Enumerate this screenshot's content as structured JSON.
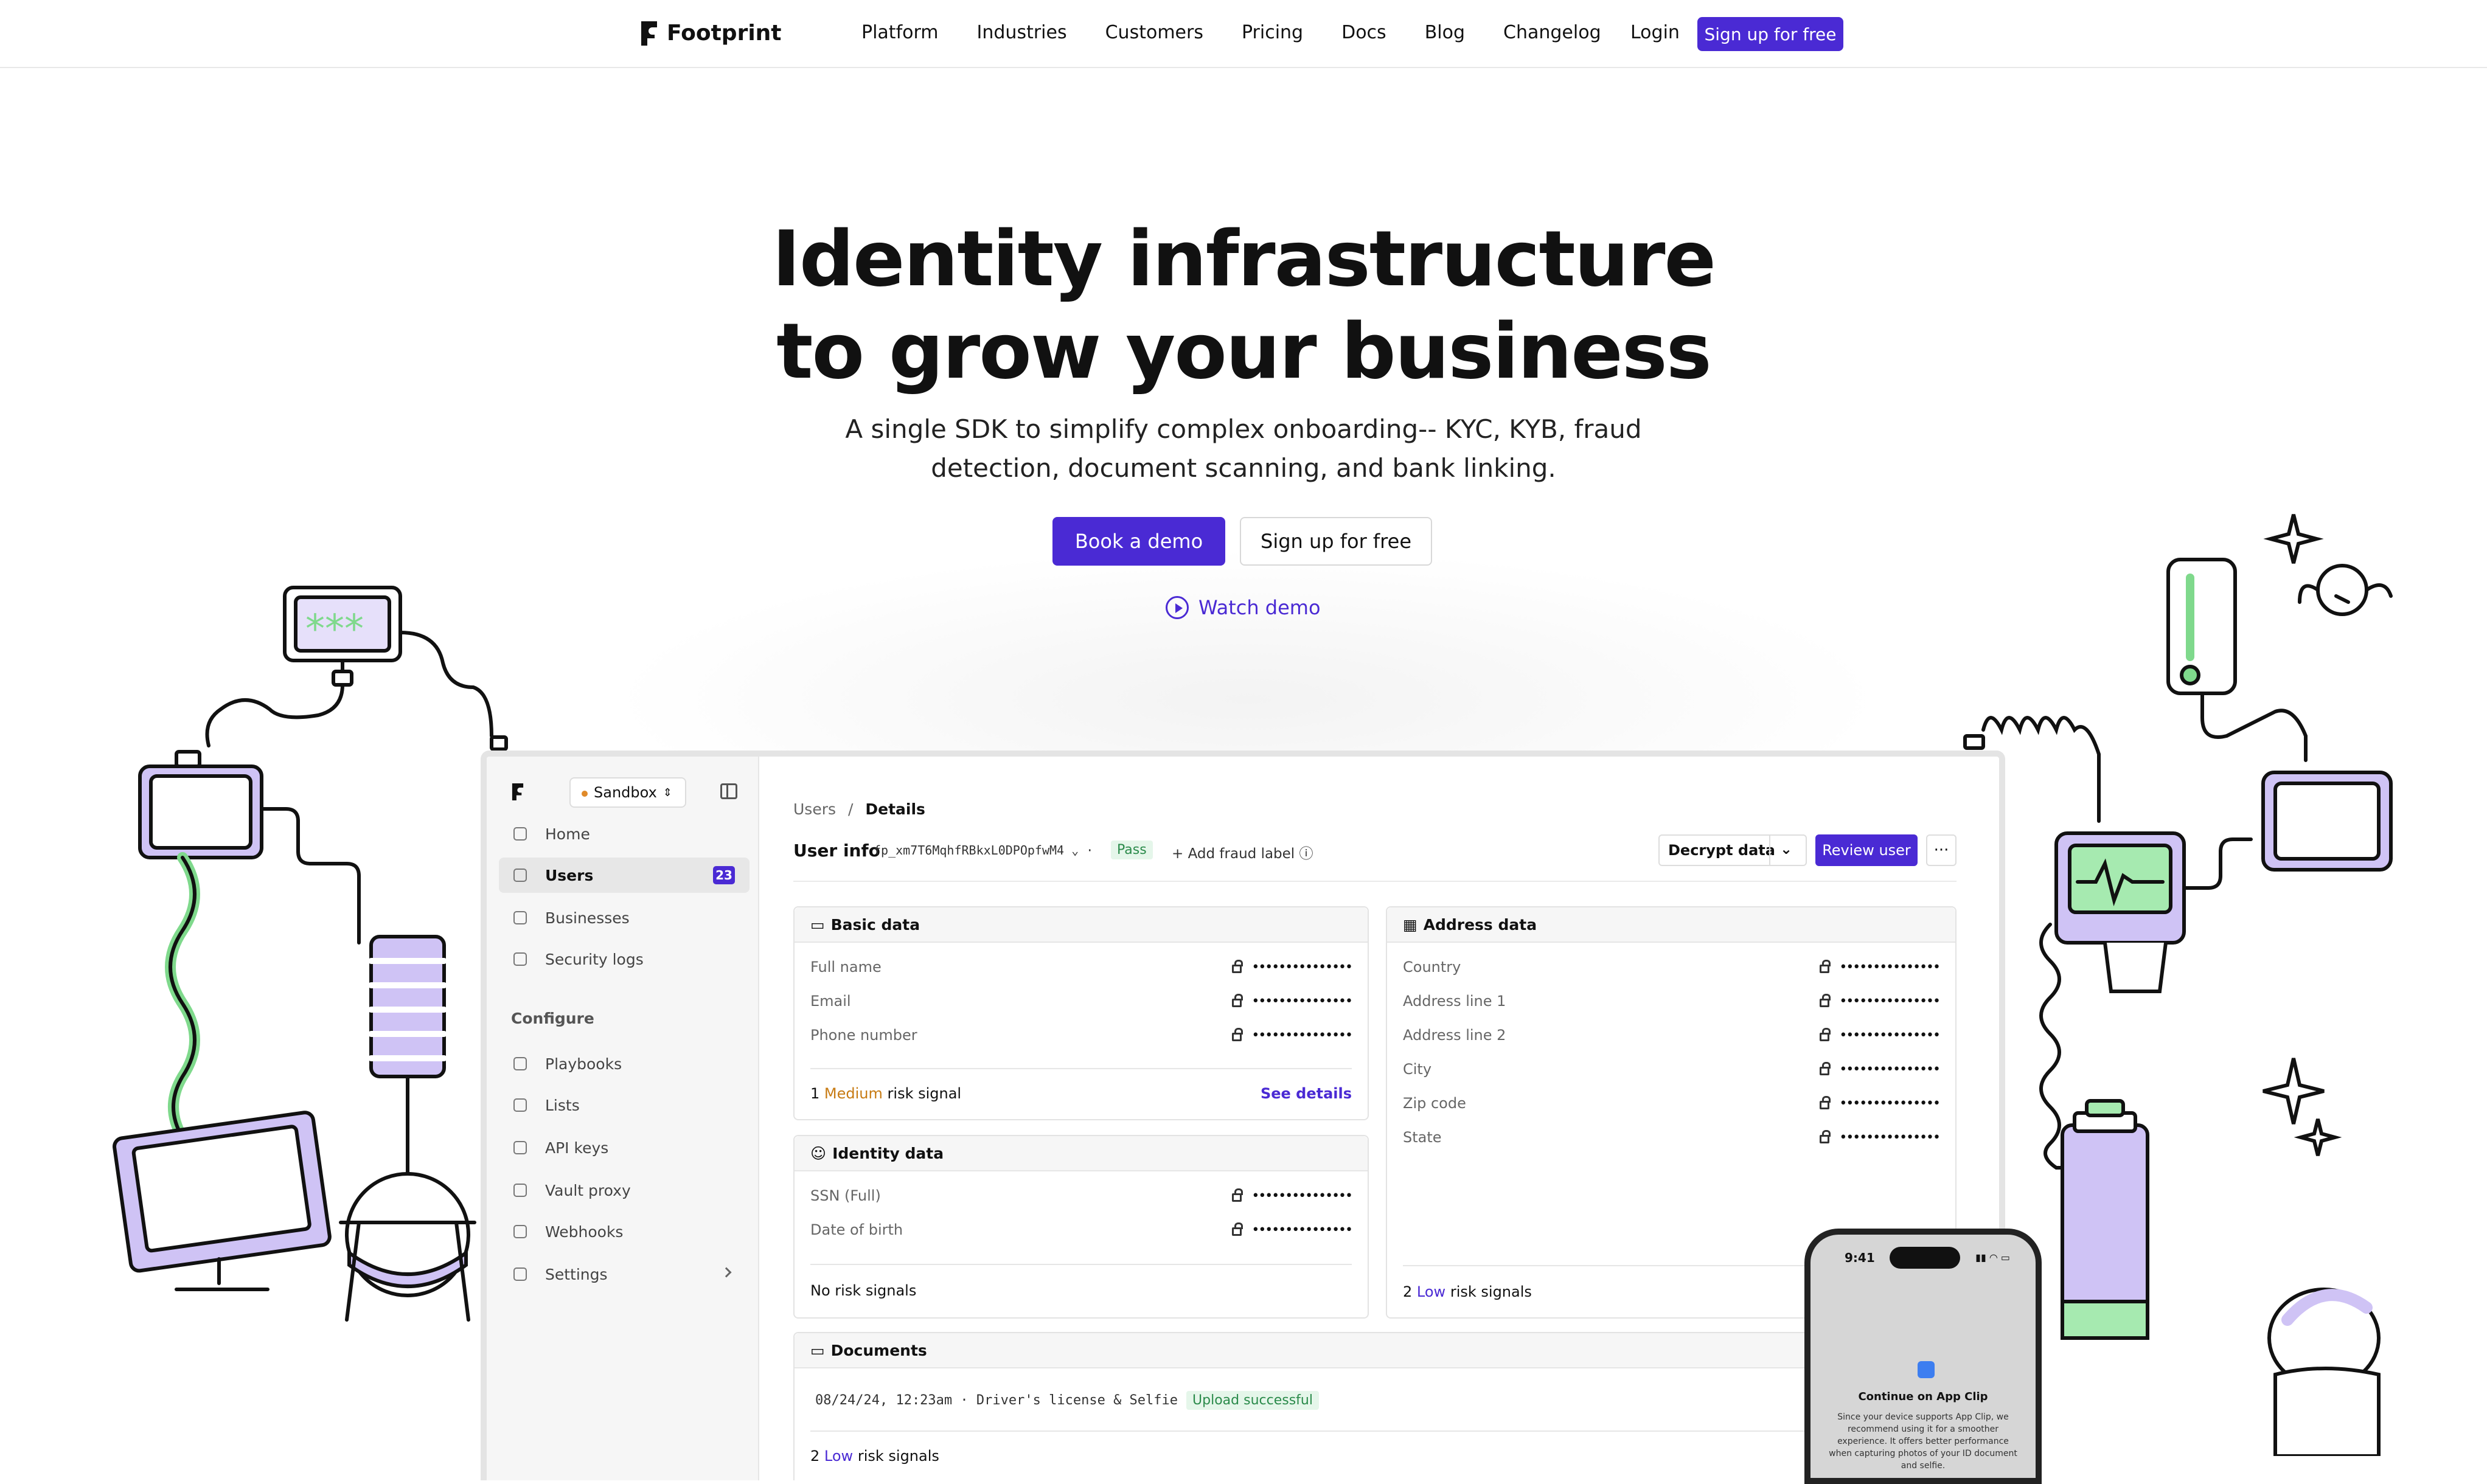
{
  "nav": {
    "brand": "Footprint",
    "links": [
      "Platform",
      "Industries",
      "Customers",
      "Pricing",
      "Docs",
      "Blog",
      "Changelog"
    ],
    "login": "Login",
    "signup": "Sign up for free"
  },
  "hero": {
    "title_line1": "Identity infrastructure",
    "title_line2": "to grow your business",
    "subtitle_line1": "A single SDK to simplify complex onboarding-- KYC, KYB, fraud",
    "subtitle_line2": "detection, document scanning, and bank linking.",
    "book_demo": "Book a demo",
    "sign_up": "Sign up for free",
    "watch_demo": "Watch demo"
  },
  "dashboard": {
    "env": "Sandbox",
    "sidebar": {
      "items": [
        {
          "label": "Home",
          "icon": "home-icon"
        },
        {
          "label": "Users",
          "icon": "users-icon",
          "badge": "23"
        },
        {
          "label": "Businesses",
          "icon": "store-icon"
        },
        {
          "label": "Security logs",
          "icon": "file-icon"
        }
      ],
      "section": "Configure",
      "config_items": [
        {
          "label": "Playbooks",
          "icon": "book-icon"
        },
        {
          "label": "Lists",
          "icon": "shuffle-icon"
        },
        {
          "label": "API keys",
          "icon": "key-icon"
        },
        {
          "label": "Vault proxy",
          "icon": "layers-icon"
        },
        {
          "label": "Webhooks",
          "icon": "webhook-icon"
        },
        {
          "label": "Settings",
          "icon": "gear-icon"
        }
      ]
    },
    "breadcrumb": {
      "parent": "Users",
      "sep": "/",
      "current": "Details"
    },
    "user_info_label": "User info",
    "user_id": "fp_xm7T6MqhfRBkxL0DPOpfwM4",
    "status": "Pass",
    "add_fraud_label": "Add fraud label",
    "decrypt": "Decrypt data",
    "review": "Review user",
    "more": "···",
    "masked": "•••••••••••••••",
    "basic": {
      "title": "Basic data",
      "fields": [
        "Full name",
        "Email",
        "Phone number"
      ],
      "risk_count": "1",
      "risk_level": "Medium",
      "risk_suffix": "risk signal",
      "see_details": "See details"
    },
    "identity": {
      "title": "Identity data",
      "fields": [
        "SSN (Full)",
        "Date of birth"
      ],
      "risk": "No risk signals"
    },
    "address": {
      "title": "Address data",
      "fields": [
        "Country",
        "Address line 1",
        "Address line 2",
        "City",
        "Zip code",
        "State"
      ],
      "risk_count": "2",
      "risk_level": "Low",
      "risk_suffix": "risk signals"
    },
    "documents": {
      "title": "Documents",
      "entry": "08/24/24, 12:23am · Driver's license & Selfie",
      "status": "Upload successful",
      "risk_count": "2",
      "risk_level": "Low",
      "risk_suffix": "risk signals"
    }
  },
  "phone": {
    "time": "9:41",
    "title": "Continue on App Clip",
    "desc": "Since your device supports App Clip, we recommend using it for a smoother experience. It offers better performance when capturing photos of your ID document and selfie."
  },
  "colors": {
    "accent": "#4a2ad4",
    "illustration_purple": "#cfc3f5",
    "illustration_green": "#a6eab0"
  }
}
